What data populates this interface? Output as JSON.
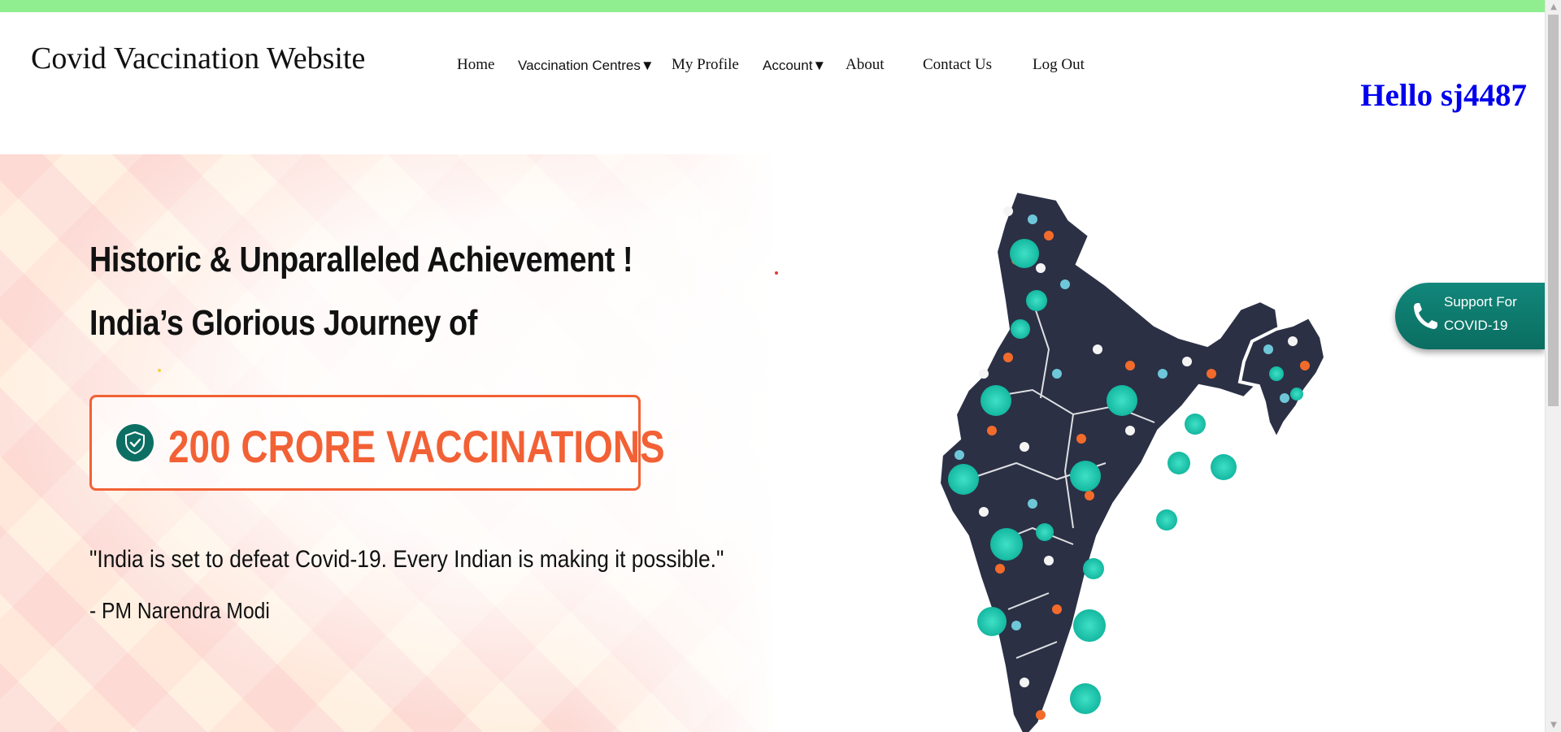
{
  "site": {
    "title": "Covid Vaccination Website"
  },
  "nav": {
    "home": "Home",
    "centres": "Vaccination Centres▼",
    "profile": "My Profile",
    "account": "Account▼",
    "about": "About",
    "contact": "Contact Us",
    "logout": "Log Out"
  },
  "user": {
    "greeting": "Hello sj4487"
  },
  "hero": {
    "headline1": "Historic & Unparalleled Achievement !",
    "headline2": "India’s Glorious Journey of",
    "milestone": "200 CRORE VACCINATIONS",
    "quote": "\"India is set to defeat Covid-19. Every Indian is making it possible.\"",
    "author": "- PM Narendra Modi"
  },
  "support": {
    "line1": "Support For",
    "line2": "COVID-19"
  },
  "colors": {
    "topbar": "#90ee90",
    "greeting": "#0000ee",
    "accent_orange": "#f26135",
    "accent_teal": "#0d6f63"
  },
  "icons": {
    "shield": "shield-check-icon",
    "phone": "phone-icon",
    "map": "india-map-illustration"
  }
}
